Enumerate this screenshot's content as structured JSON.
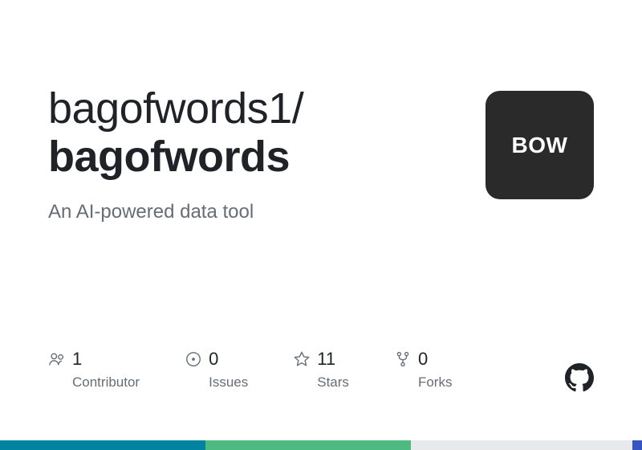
{
  "repo": {
    "owner": "bagofwords1",
    "name": "bagofwords",
    "description": "An AI-powered data tool"
  },
  "logo": {
    "text": "BOW"
  },
  "stats": {
    "contributors": {
      "value": "1",
      "label": "Contributor"
    },
    "issues": {
      "value": "0",
      "label": "Issues"
    },
    "stars": {
      "value": "11",
      "label": "Stars"
    },
    "forks": {
      "value": "0",
      "label": "Forks"
    }
  }
}
